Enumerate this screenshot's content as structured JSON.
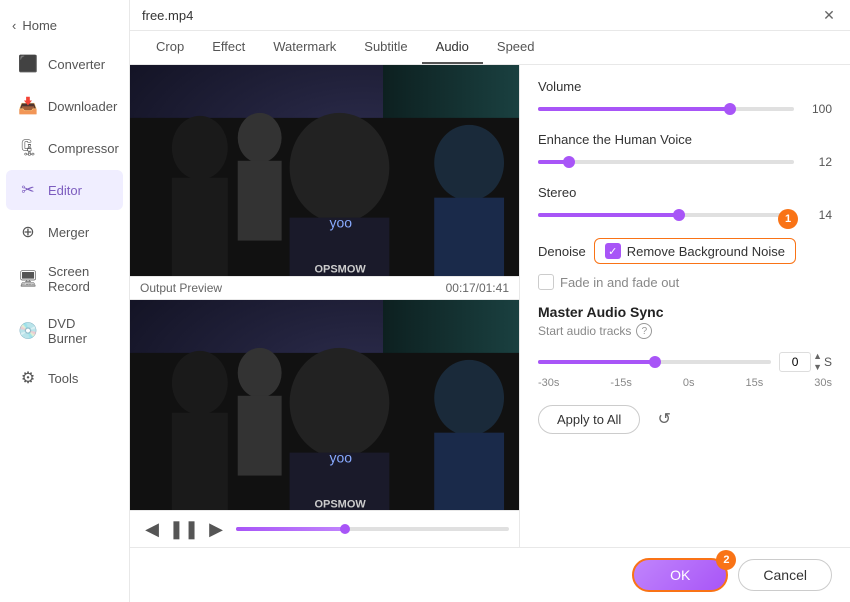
{
  "sidebar": {
    "back_label": "Home",
    "items": [
      {
        "id": "converter",
        "label": "Converter",
        "icon": "⬇"
      },
      {
        "id": "downloader",
        "label": "Downloader",
        "icon": "📥"
      },
      {
        "id": "compressor",
        "label": "Compressor",
        "icon": "🗜"
      },
      {
        "id": "editor",
        "label": "Editor",
        "icon": "✂",
        "active": true
      },
      {
        "id": "merger",
        "label": "Merger",
        "icon": "⊕"
      },
      {
        "id": "screen-record",
        "label": "Screen Record",
        "icon": "⊡"
      },
      {
        "id": "dvd-burner",
        "label": "DVD Burner",
        "icon": "💿"
      },
      {
        "id": "tools",
        "label": "Tools",
        "icon": "⚙"
      }
    ]
  },
  "titlebar": {
    "filename": "free.mp4",
    "close_label": "✕"
  },
  "tabs": [
    {
      "id": "crop",
      "label": "Crop"
    },
    {
      "id": "effect",
      "label": "Effect"
    },
    {
      "id": "watermark",
      "label": "Watermark"
    },
    {
      "id": "subtitle",
      "label": "Subtitle"
    },
    {
      "id": "audio",
      "label": "Audio",
      "active": true
    },
    {
      "id": "speed",
      "label": "Speed"
    }
  ],
  "video": {
    "output_preview_label": "Output Preview",
    "timestamp": "00:17/01:41"
  },
  "audio": {
    "volume_label": "Volume",
    "volume_value": "100",
    "enhance_label": "Enhance the Human Voice",
    "enhance_value": "12",
    "stereo_label": "Stereo",
    "stereo_value": "14",
    "denoise_label": "Denoise",
    "denoise_checkbox_label": "Remove Background Noise",
    "fade_label": "Fade in and fade out",
    "master_title": "Master Audio Sync",
    "master_subtitle": "Start audio tracks",
    "sync_value": "0",
    "sync_unit": "S",
    "sync_labels": [
      "-30s",
      "-15s",
      "0s",
      "15s",
      "30s"
    ],
    "apply_all_label": "Apply to All",
    "reset_icon": "↺"
  },
  "bottom": {
    "ok_label": "OK",
    "cancel_label": "Cancel"
  }
}
